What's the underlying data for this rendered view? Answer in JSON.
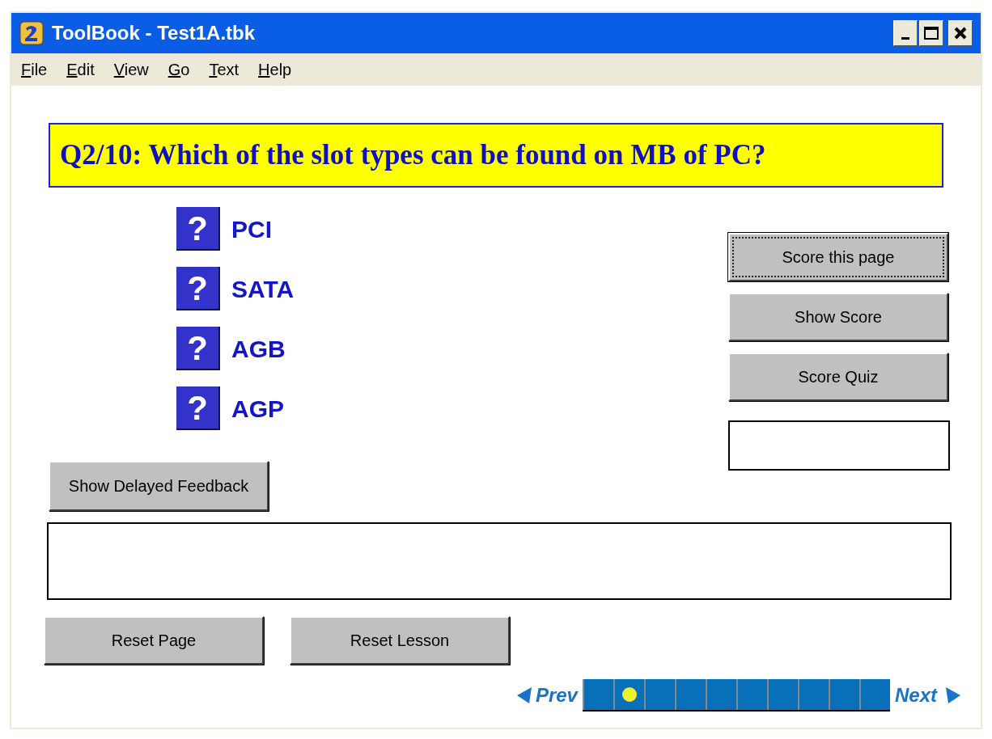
{
  "window": {
    "title": "ToolBook - Test1A.tbk"
  },
  "menu": [
    "File",
    "Edit",
    "View",
    "Go",
    "Text",
    "Help"
  ],
  "question": "Q2/10: Which of the slot types can be found on MB of PC?",
  "options": [
    {
      "mark": "?",
      "label": "PCI"
    },
    {
      "mark": "?",
      "label": "SATA"
    },
    {
      "mark": "?",
      "label": "AGB"
    },
    {
      "mark": "?",
      "label": "AGP"
    }
  ],
  "score_buttons": [
    {
      "label": "Score this page",
      "focused": true
    },
    {
      "label": "Show Score",
      "focused": false
    },
    {
      "label": "Score Quiz",
      "focused": false
    }
  ],
  "feedback_button": "Show Delayed Feedback",
  "reset_buttons": [
    "Reset Page",
    "Reset Lesson"
  ],
  "nav": {
    "prev": "Prev",
    "next": "Next",
    "pages": [
      {
        "selected": false
      },
      {
        "selected": true
      },
      {
        "selected": false
      },
      {
        "selected": false
      },
      {
        "selected": false
      },
      {
        "selected": false
      },
      {
        "selected": false
      },
      {
        "selected": false
      },
      {
        "selected": false
      },
      {
        "selected": false
      }
    ]
  }
}
